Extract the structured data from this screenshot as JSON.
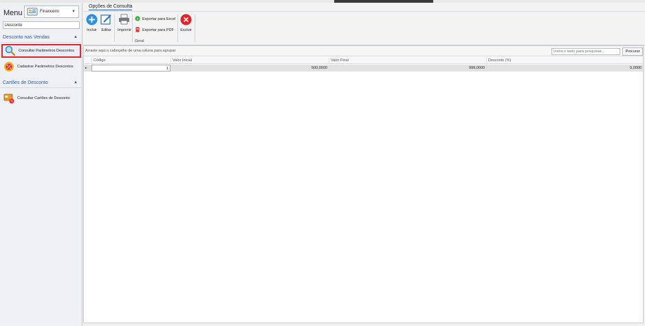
{
  "sidebar": {
    "menu_title": "Menu",
    "module": {
      "label": "Financeiro",
      "icon": "finance-icon"
    },
    "search_value": "Desconto",
    "groups": [
      {
        "title": "Desconto nas Vendas",
        "items": [
          {
            "label": "Consultar Parâmetros Descontos",
            "icon": "magnifier-icon",
            "selected": true
          },
          {
            "label": "Cadastrar Parâmetros Descontos",
            "icon": "percent-badge-icon",
            "selected": false
          }
        ]
      },
      {
        "title": "Cartões de Desconto",
        "items": [
          {
            "label": "Consultar Cartões de Desconto",
            "icon": "discount-card-icon",
            "selected": false
          }
        ]
      }
    ]
  },
  "ribbon": {
    "tab": "Opções de Consulta",
    "buttons": {
      "incluir": "Incluir",
      "editar": "Editar",
      "imprimir": "Imprimir",
      "excluir": "Excluir"
    },
    "export_excel": "Exportar para Excel",
    "export_pdf": "Exportar para PDF",
    "group_label": "Geral"
  },
  "grid": {
    "group_hint": "Arraste aqui o cabeçalho de uma coluna para agrupar",
    "search_placeholder": "Insira o texto para pesquisar...",
    "search_button": "Procurar",
    "columns": [
      "Código",
      "Valor Inicial",
      "Valor Final",
      "Desconto (%)"
    ],
    "rows": [
      {
        "codigo": "1",
        "valor_inicial": "500,0000",
        "valor_final": "999,0000",
        "desconto": "5,0000"
      }
    ]
  },
  "colors": {
    "accent": "#2a5da8",
    "selection_border": "#e0242b",
    "add_button": "#2d8fe0",
    "delete_button": "#e0242b"
  }
}
